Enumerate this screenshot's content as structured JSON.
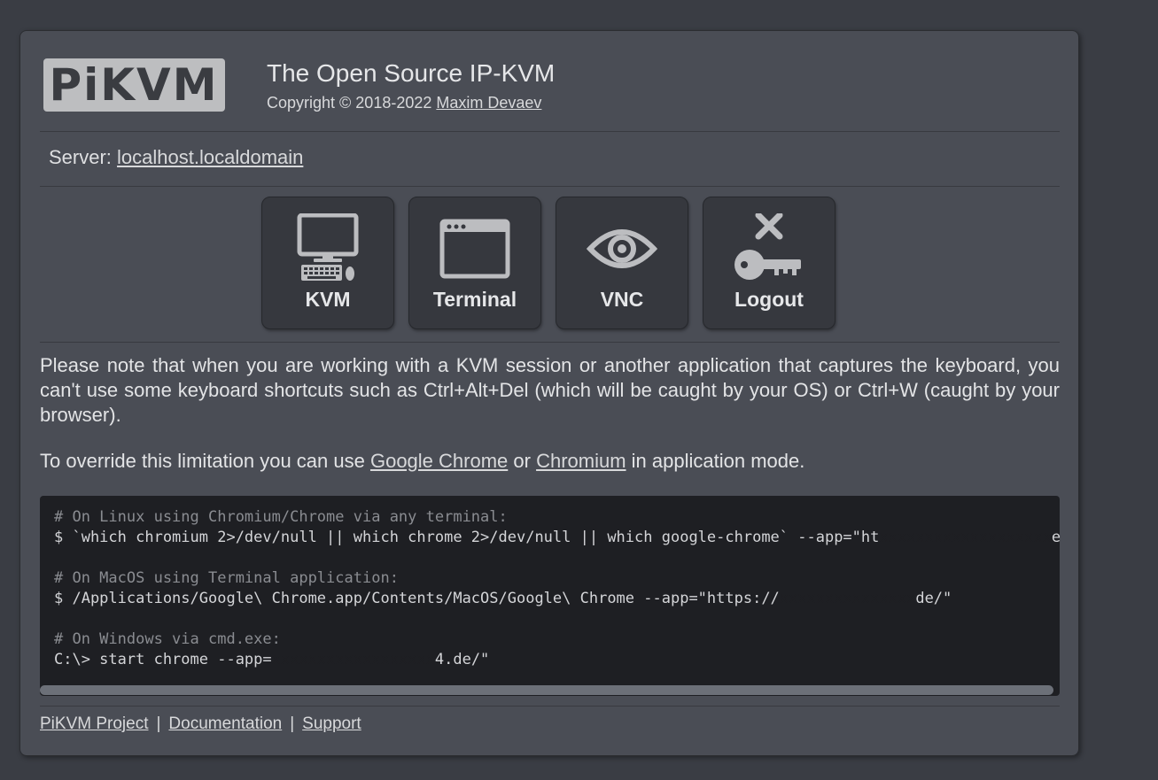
{
  "header": {
    "logo_text": "PiKVM",
    "title": "The Open Source IP-KVM",
    "copyright_prefix": "Copyright © 2018-2022 ",
    "author_link": "Maxim Devaev"
  },
  "server": {
    "label": "Server: ",
    "host_link": "localhost.localdomain"
  },
  "buttons": [
    {
      "label": "KVM",
      "icon": "monitor-icon"
    },
    {
      "label": "Terminal",
      "icon": "terminal-window-icon"
    },
    {
      "label": "VNC",
      "icon": "eye-icon"
    },
    {
      "label": "Logout",
      "icon": "key-cross-icon"
    }
  ],
  "note": {
    "paragraph1": "Please note that when you are working with a KVM session or another application that captures the keyboard, you can't use some keyboard shortcuts such as Ctrl+Alt+Del (which will be caught by your OS) or Ctrl+W (caught by your browser).",
    "p2_prefix": "To override this limitation you can use ",
    "link_chrome": "Google Chrome",
    "p2_or": " or ",
    "link_chromium": "Chromium",
    "p2_suffix": " in application mode."
  },
  "code": {
    "comment1": "# On Linux using Chromium/Chrome via any terminal:",
    "cmd1": "$ `which chromium 2>/dev/null || which chrome 2>/dev/null || which google-chrome` --app=\"ht",
    "cmd1_tail": "e/\"",
    "comment2": "# On MacOS using Terminal application:",
    "cmd2": "$ /Applications/Google\\ Chrome.app/Contents/MacOS/Google\\ Chrome --app=\"https://",
    "cmd2_tail": "de/\"",
    "comment3": "# On Windows via cmd.exe:",
    "cmd3": "C:\\> start chrome --app=",
    "cmd3_tail": "4.de/\""
  },
  "footer": {
    "project_link": "PiKVM Project",
    "separator": "|",
    "docs_link": "Documentation",
    "support_link": "Support"
  },
  "colors": {
    "background": "#3a3d44",
    "panel": "#4a4d55",
    "button": "#36383e",
    "code_bg": "#1e1f23",
    "logo_bg": "#bdbec0"
  }
}
